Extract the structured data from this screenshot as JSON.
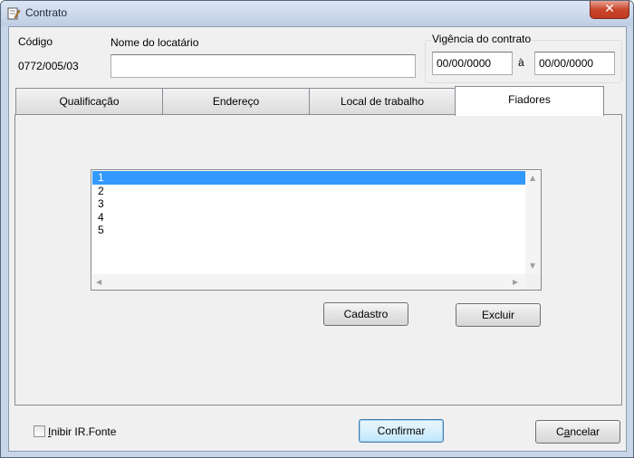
{
  "window": {
    "title": "Contrato",
    "close_glyph": "✕",
    "icon": "document-edit-icon"
  },
  "header": {
    "codigo_label": "Código",
    "codigo_value": "0772/005/03",
    "locatario_label": "Nome do locatário",
    "locatario_value": "",
    "vigencia_label": "Vigência do contrato",
    "vigencia_start": "00/00/0000",
    "vigencia_sep": "à",
    "vigencia_end": "00/00/0000"
  },
  "tabs": [
    {
      "label": "Qualificação",
      "active": false
    },
    {
      "label": "Endereço",
      "active": false
    },
    {
      "label": "Local de trabalho",
      "active": false
    },
    {
      "label": "Fiadores",
      "active": true
    }
  ],
  "fiadores": {
    "items": [
      "1",
      "2",
      "3",
      "4",
      "5"
    ],
    "selected_index": 0,
    "cadastro_label": "Cadastro",
    "excluir_label": "Excluir"
  },
  "footer": {
    "inibir_prefix": "I",
    "inibir_rest": "nibir IR.Fonte",
    "inibir_checked": false,
    "confirmar_label": "Confirmar",
    "cancelar_prefix": "C",
    "cancelar_mid": "a",
    "cancelar_rest": "ncelar"
  }
}
